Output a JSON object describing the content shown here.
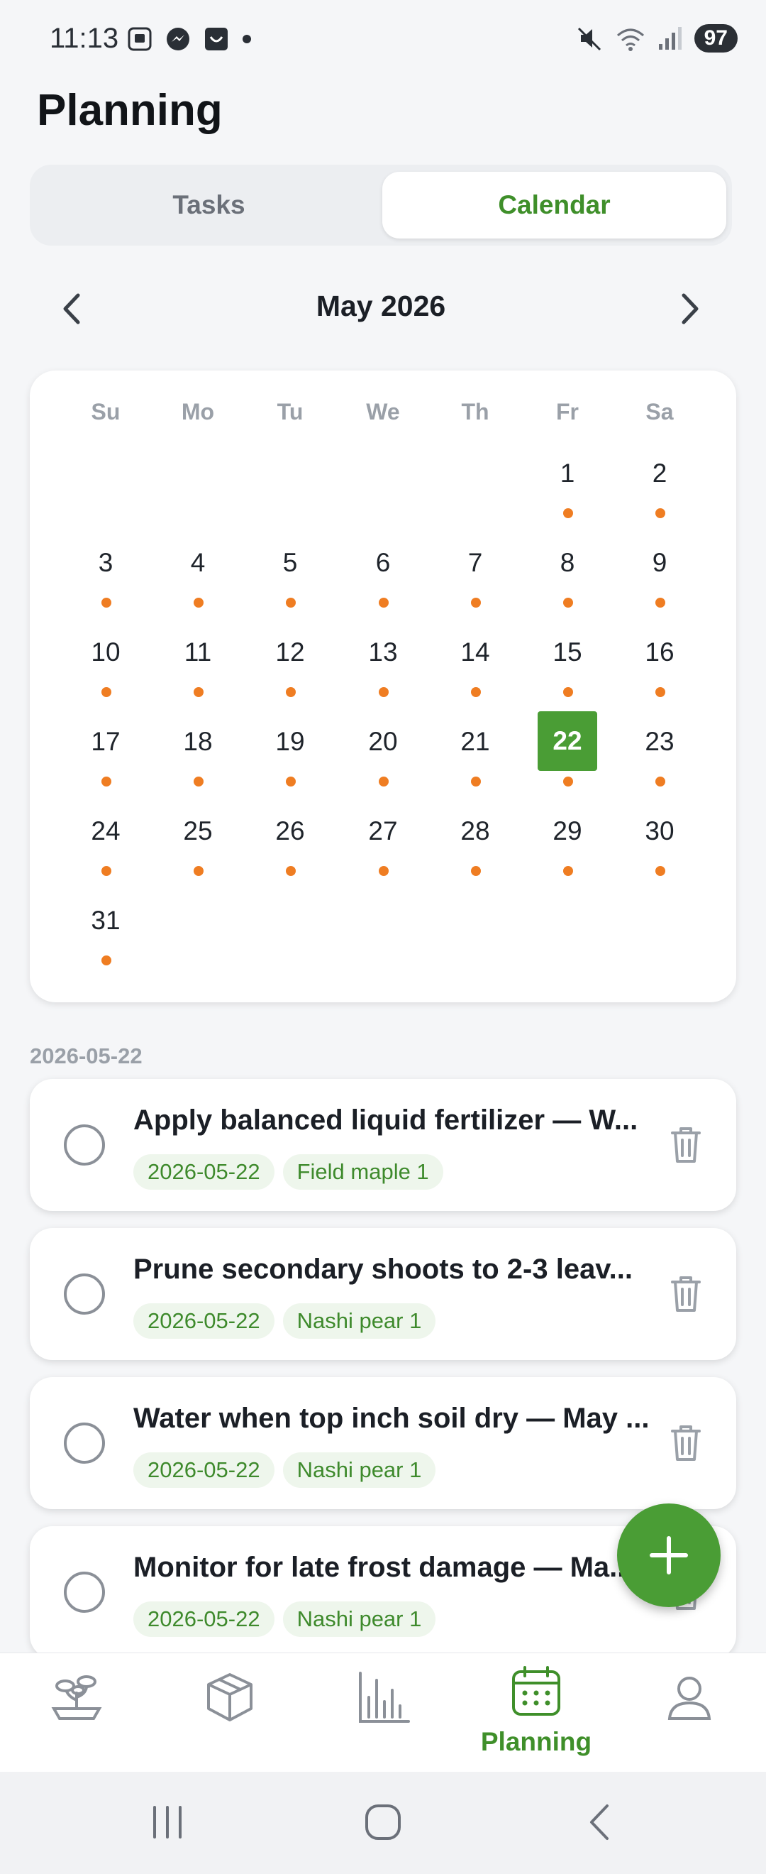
{
  "status_bar": {
    "time": "11:13",
    "battery": "97",
    "left_icons": [
      "screenshot-icon",
      "messenger-icon",
      "bag-icon",
      "dot-icon"
    ],
    "right_icons": [
      "mute-icon",
      "wifi-icon",
      "signal-icon"
    ]
  },
  "page": {
    "title": "Planning"
  },
  "segment": {
    "tasks_label": "Tasks",
    "calendar_label": "Calendar",
    "selected": "Calendar"
  },
  "calendar": {
    "month_label": "May 2026",
    "weekdays": [
      "Su",
      "Mo",
      "Tu",
      "We",
      "Th",
      "Fr",
      "Sa"
    ],
    "first_weekday_index": 5,
    "days_in_month": 31,
    "selected_day": 22,
    "days_with_tasks": [
      1,
      2,
      3,
      4,
      5,
      6,
      7,
      8,
      9,
      10,
      11,
      12,
      13,
      14,
      15,
      16,
      17,
      18,
      19,
      20,
      21,
      22,
      23,
      24,
      25,
      26,
      27,
      28,
      29,
      30,
      31
    ],
    "dot_color": "#ef7d22",
    "selected_color": "#4a9d35"
  },
  "tasks_section": {
    "date_header": "2026-05-22",
    "tasks": [
      {
        "title": "Apply balanced liquid fertilizer — W...",
        "date": "2026-05-22",
        "tree": "Field maple 1"
      },
      {
        "title": "Prune secondary shoots to 2-3 leav...",
        "date": "2026-05-22",
        "tree": "Nashi pear 1"
      },
      {
        "title": "Water when top inch soil dry — May ...",
        "date": "2026-05-22",
        "tree": "Nashi pear 1"
      },
      {
        "title": "Monitor for late frost damage — Ma...",
        "date": "2026-05-22",
        "tree": "Nashi pear 1"
      }
    ]
  },
  "fab": {
    "icon": "plus-icon"
  },
  "bottom_nav": {
    "items": [
      {
        "icon": "bonsai-icon",
        "label": ""
      },
      {
        "icon": "box-icon",
        "label": ""
      },
      {
        "icon": "bar-chart-icon",
        "label": ""
      },
      {
        "icon": "calendar-icon",
        "label": "Planning",
        "active": true
      },
      {
        "icon": "user-icon",
        "label": ""
      }
    ]
  },
  "colors": {
    "accent": "#4a9d35",
    "accent_text": "#3f8f2a",
    "dot": "#ef7d22"
  }
}
